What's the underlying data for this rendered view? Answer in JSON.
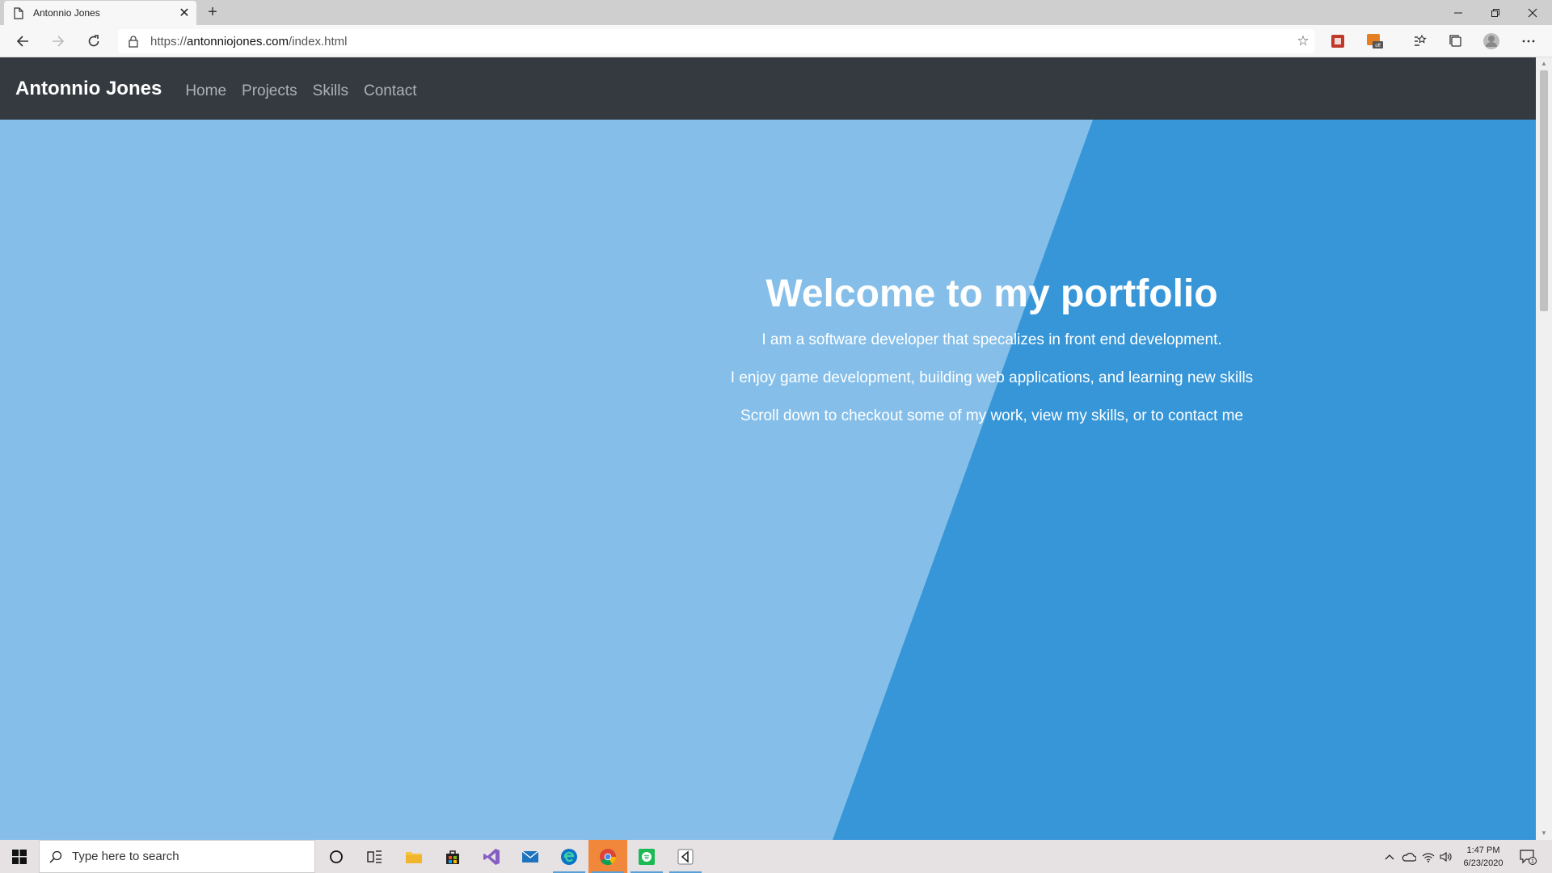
{
  "browser": {
    "tab_title": "Antonnio Jones",
    "url_prefix": "https://",
    "url_host": "antonniojones.com",
    "url_path": "/index.html"
  },
  "site": {
    "brand": "Antonnio Jones",
    "nav": [
      "Home",
      "Projects",
      "Skills",
      "Contact"
    ]
  },
  "hero": {
    "title": "Welcome to my portfolio",
    "line1": "I am a software developer that specalizes in front end development.",
    "line2": "I enjoy game development, building web applications, and learning new skills",
    "line3": "Scroll down to checkout some of my work, view my skills, or to contact me"
  },
  "taskbar": {
    "search_placeholder": "Type here to search",
    "time": "1:47 PM",
    "date": "6/23/2020",
    "notification_count": "1"
  },
  "colors": {
    "hero_light": "#85bfe9",
    "hero_dark": "#3696d8",
    "navbar": "#343a40"
  }
}
